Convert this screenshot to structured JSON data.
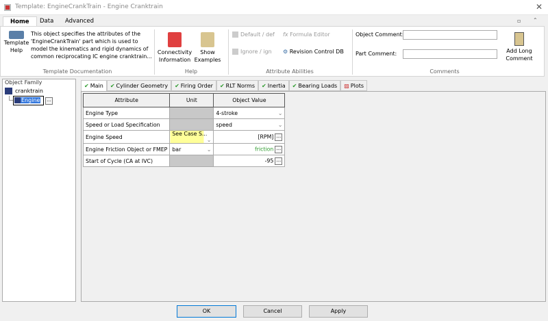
{
  "window": {
    "title": "Template: EngineCrankTrain - Engine Cranktrain"
  },
  "ribbon_tabs": [
    "Home",
    "Data",
    "Advanced"
  ],
  "template_doc": {
    "button": "Template Help",
    "description": "This object specifies the attributes of the 'EngineCrankTrain' part which is used to model the kinematics and rigid dynamics of common reciprocating IC engine cranktrain...",
    "group": "Template Documentation"
  },
  "help": {
    "connectivity": "Connectivity Information",
    "examples": "Show Examples",
    "group": "Help"
  },
  "attr_abilities": {
    "default": "Default / def",
    "ignore": "Ignore / ign",
    "formula": "Formula Editor",
    "revision": "Revision Control DB",
    "group": "Attribute Abilities"
  },
  "comments": {
    "object_label": "Object Comment:",
    "object_value": "",
    "part_label": "Part Comment:",
    "part_value": "",
    "long": "Add Long Comment",
    "group": "Comments"
  },
  "object_family": {
    "title": "Object Family",
    "root": "cranktrain",
    "child": "Engine"
  },
  "tabs": [
    "Main",
    "Cylinder Geometry",
    "Firing Order",
    "RLT Norms",
    "Inertia",
    "Bearing Loads",
    "Plots"
  ],
  "table": {
    "headers": [
      "Attribute",
      "Unit",
      "Object Value"
    ],
    "rows": [
      {
        "attr": "Engine Type",
        "unit": "",
        "value": "4-stroke"
      },
      {
        "attr": "Speed or Load Specification",
        "unit": "",
        "value": "speed"
      },
      {
        "attr": "Engine Speed",
        "unit": "See Case S...",
        "value": "[RPM]"
      },
      {
        "attr": "Engine Friction Object or FMEP",
        "unit": "bar",
        "value": "friction"
      },
      {
        "attr": "Start of Cycle (CA at IVC)",
        "unit": "",
        "value": "-95"
      }
    ]
  },
  "buttons": {
    "ok": "OK",
    "cancel": "Cancel",
    "apply": "Apply"
  },
  "ellipsis": "..."
}
